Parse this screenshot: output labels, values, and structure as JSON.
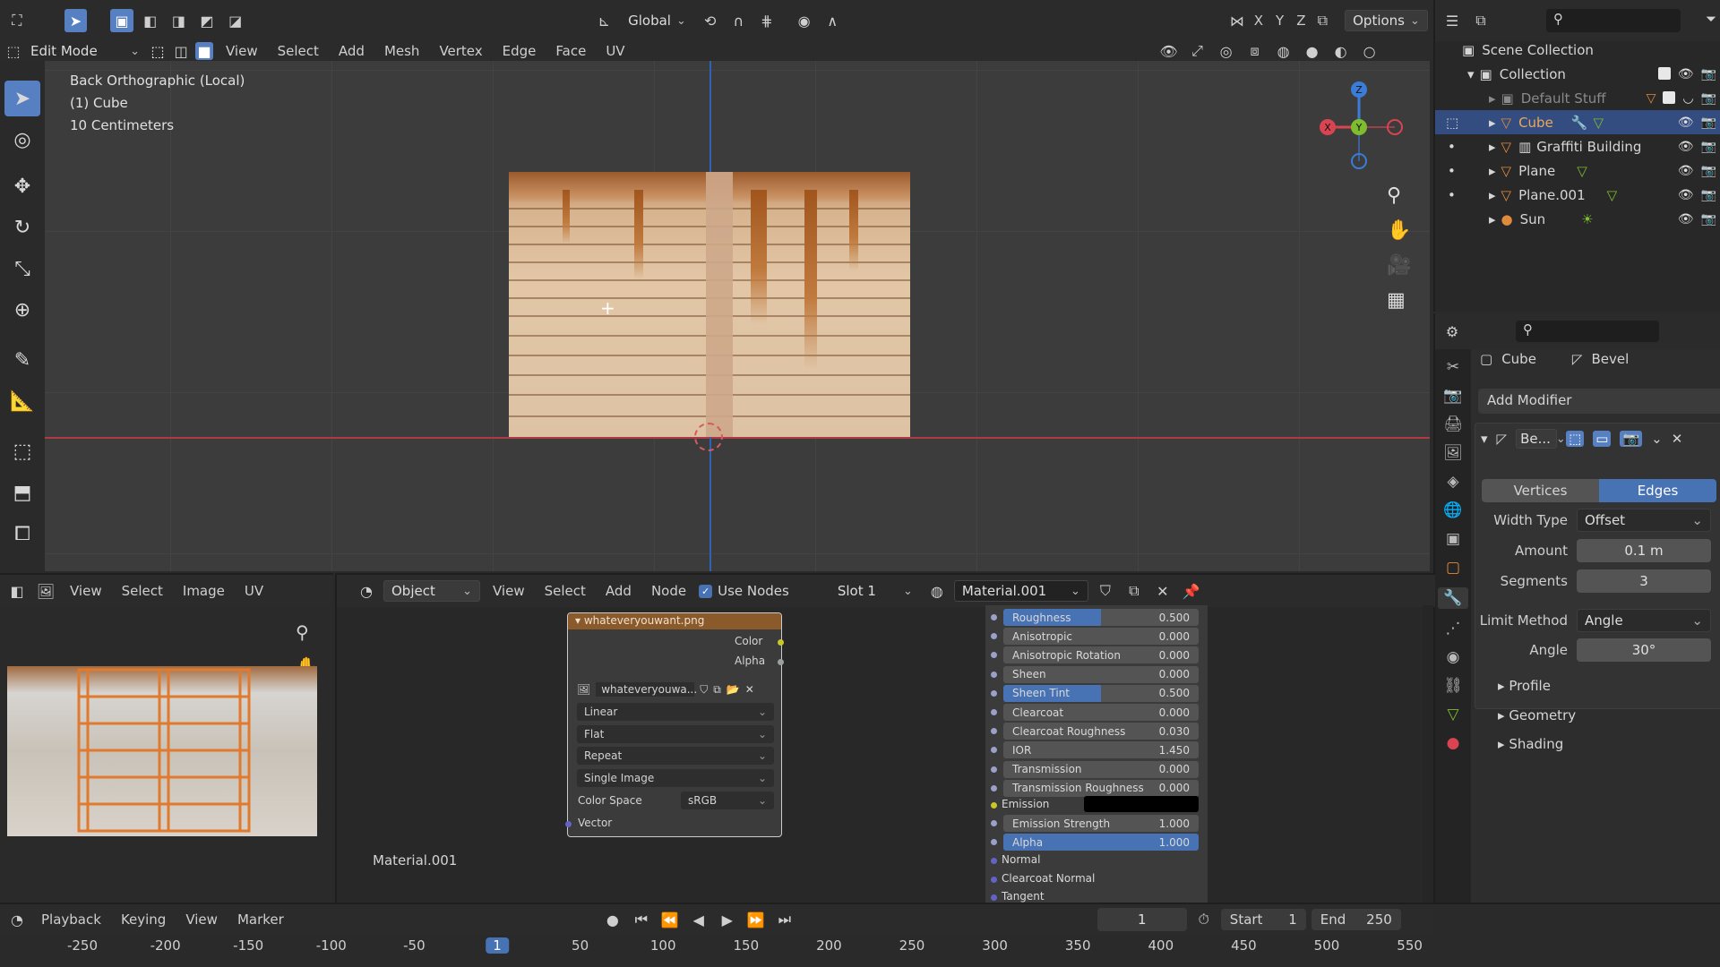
{
  "top": {
    "orientation": "Global",
    "options": "Options",
    "axes": [
      "X",
      "Y",
      "Z"
    ]
  },
  "viewport_header": {
    "mode": "Edit Mode",
    "menus": [
      "View",
      "Select",
      "Add",
      "Mesh",
      "Vertex",
      "Edge",
      "Face",
      "UV"
    ]
  },
  "viewport": {
    "view_name": "Back Orthographic (Local)",
    "object": "(1) Cube",
    "scale": "10 Centimeters",
    "gizmo": {
      "z": "Z",
      "y": "Y",
      "x": "X"
    }
  },
  "outliner": {
    "scene_collection": "Scene Collection",
    "collection": "Collection",
    "items": [
      {
        "label": "Default Stuff"
      },
      {
        "label": "Cube"
      },
      {
        "label": "Graffiti Building"
      },
      {
        "label": "Plane"
      },
      {
        "label": "Plane.001"
      },
      {
        "label": "Sun"
      }
    ]
  },
  "properties": {
    "object": "Cube",
    "modifier_name": "Bevel",
    "add_modifier": "Add Modifier",
    "modifier_short": "Be...",
    "tabs": [
      "Vertices",
      "Edges"
    ],
    "width_type_label": "Width Type",
    "width_type": "Offset",
    "amount_label": "Amount",
    "amount": "0.1 m",
    "segments_label": "Segments",
    "segments": "3",
    "limit_method_label": "Limit Method",
    "limit_method": "Angle",
    "angle_label": "Angle",
    "angle": "30°",
    "sections": [
      "Profile",
      "Geometry",
      "Shading"
    ]
  },
  "uv_editor": {
    "menus": [
      "View",
      "Select",
      "Image",
      "UV"
    ]
  },
  "node_editor": {
    "object_dd": "Object",
    "menus": [
      "View",
      "Select",
      "Add",
      "Node"
    ],
    "use_nodes": "Use Nodes",
    "slot": "Slot 1",
    "material": "Material.001",
    "material_label": "Material.001",
    "image_node": {
      "title": "whateveryouwant.png",
      "out_color": "Color",
      "out_alpha": "Alpha",
      "image_name": "whateveryouwa...",
      "interpolation": "Linear",
      "projection": "Flat",
      "extension": "Repeat",
      "source": "Single Image",
      "color_space_label": "Color Space",
      "color_space": "sRGB",
      "vector": "Vector"
    },
    "bsdf_rows": [
      {
        "label": "Roughness",
        "value": "0.500",
        "fill": 0.5
      },
      {
        "label": "Anisotropic",
        "value": "0.000",
        "fill": 0
      },
      {
        "label": "Anisotropic Rotation",
        "value": "0.000",
        "fill": 0
      },
      {
        "label": "Sheen",
        "value": "0.000",
        "fill": 0
      },
      {
        "label": "Sheen Tint",
        "value": "0.500",
        "fill": 0.5
      },
      {
        "label": "Clearcoat",
        "value": "0.000",
        "fill": 0
      },
      {
        "label": "Clearcoat Roughness",
        "value": "0.030",
        "fill": 0.03
      },
      {
        "label": "IOR",
        "value": "1.450",
        "fill": 0
      },
      {
        "label": "Transmission",
        "value": "0.000",
        "fill": 0
      },
      {
        "label": "Transmission Roughness",
        "value": "0.000",
        "fill": 0
      }
    ],
    "emission": "Emission",
    "emission_strength": {
      "label": "Emission Strength",
      "value": "1.000"
    },
    "alpha": {
      "label": "Alpha",
      "value": "1.000",
      "fill": 1
    },
    "inputs": [
      "Normal",
      "Clearcoat Normal",
      "Tangent"
    ]
  },
  "timeline": {
    "menus": [
      "Playback",
      "Keying",
      "View",
      "Marker"
    ],
    "current_frame": "1",
    "start_label": "Start",
    "start": "1",
    "end_label": "End",
    "end": "250",
    "ticks": [
      "-250",
      "-200",
      "-150",
      "-100",
      "-50",
      "1",
      "50",
      "100",
      "150",
      "200",
      "250",
      "300",
      "350",
      "400",
      "450",
      "500",
      "550"
    ],
    "playhead": "1"
  },
  "colors": {
    "accent": "#4772b3",
    "selection": "#334d80",
    "x_axis": "#d94452",
    "y_axis": "#7dbd2e",
    "z_axis": "#3b7cd9"
  }
}
